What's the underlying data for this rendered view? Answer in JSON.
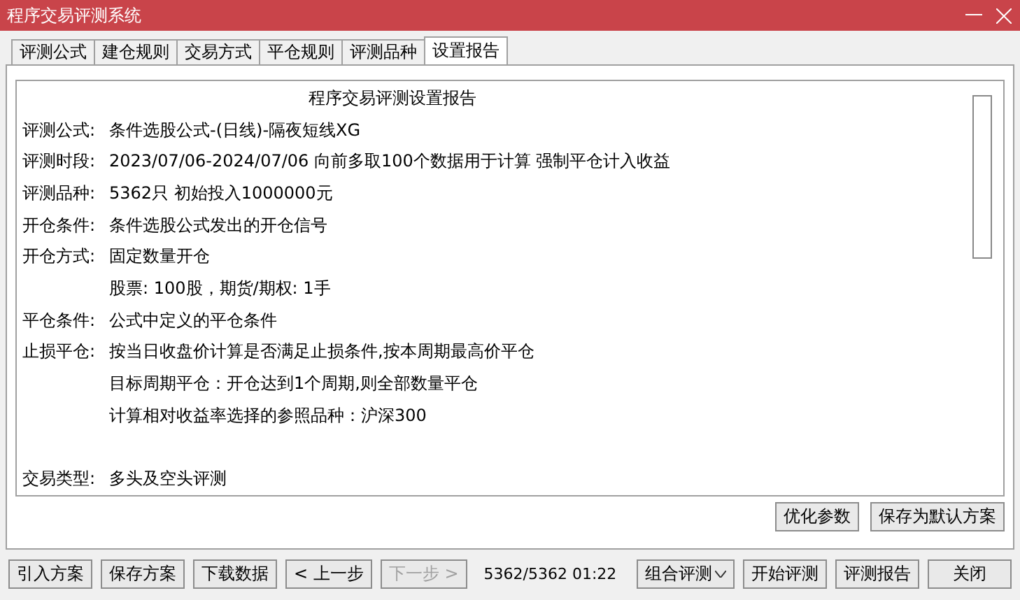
{
  "window": {
    "title": "程序交易评测系统"
  },
  "tabs": [
    {
      "label": "评测公式",
      "selected": false
    },
    {
      "label": "建仓规则",
      "selected": false
    },
    {
      "label": "交易方式",
      "selected": false
    },
    {
      "label": "平仓规则",
      "selected": false
    },
    {
      "label": "评测品种",
      "selected": false
    },
    {
      "label": "设置报告",
      "selected": true
    }
  ],
  "report": {
    "title": "程序交易评测设置报告",
    "rows": [
      {
        "kind": "field",
        "label": "评测公式:",
        "value": "条件选股公式-(日线)-隔夜短线XG"
      },
      {
        "kind": "field",
        "label": "评测时段:",
        "value": "2023/07/06-2024/07/06 向前多取100个数据用于计算 强制平仓计入收益"
      },
      {
        "kind": "field",
        "label": "评测品种:",
        "value": "5362只 初始投入1000000元"
      },
      {
        "kind": "field",
        "label": "开仓条件:",
        "value": "条件选股公式发出的开仓信号"
      },
      {
        "kind": "field",
        "label": "开仓方式:",
        "value": "固定数量开仓"
      },
      {
        "kind": "continuation",
        "value": "股票: 100股，期货/期权: 1手"
      },
      {
        "kind": "field",
        "label": "平仓条件:",
        "value": "公式中定义的平仓条件"
      },
      {
        "kind": "field",
        "label": "止损平仓:",
        "value": "按当日收盘价计算是否满足止损条件,按本周期最高价平仓"
      },
      {
        "kind": "continuation",
        "value": "目标周期平仓：开仓达到1个周期,则全部数量平仓"
      },
      {
        "kind": "continuation",
        "value": "计算相对收益率选择的参照品种：沪深300"
      },
      {
        "kind": "separated",
        "label": "交易类型:",
        "value": "多头及空头评测"
      }
    ]
  },
  "panel_buttons": [
    "优化参数",
    "保存为默认方案"
  ],
  "bottom_left_buttons": [
    {
      "label": "引入方案",
      "disabled": false
    },
    {
      "label": "保存方案",
      "disabled": false
    },
    {
      "label": "下载数据",
      "disabled": false
    },
    {
      "label": "< 上一步",
      "disabled": false
    },
    {
      "label": "下一步 >",
      "disabled": true
    }
  ],
  "status": "5362/5362 01:22",
  "bottom_right_buttons": [
    {
      "label": "组合评测",
      "kind": "dropdown"
    },
    {
      "label": "开始评测",
      "kind": "plain"
    },
    {
      "label": "评测报告",
      "kind": "plain"
    },
    {
      "label": "关闭",
      "kind": "plain"
    }
  ]
}
